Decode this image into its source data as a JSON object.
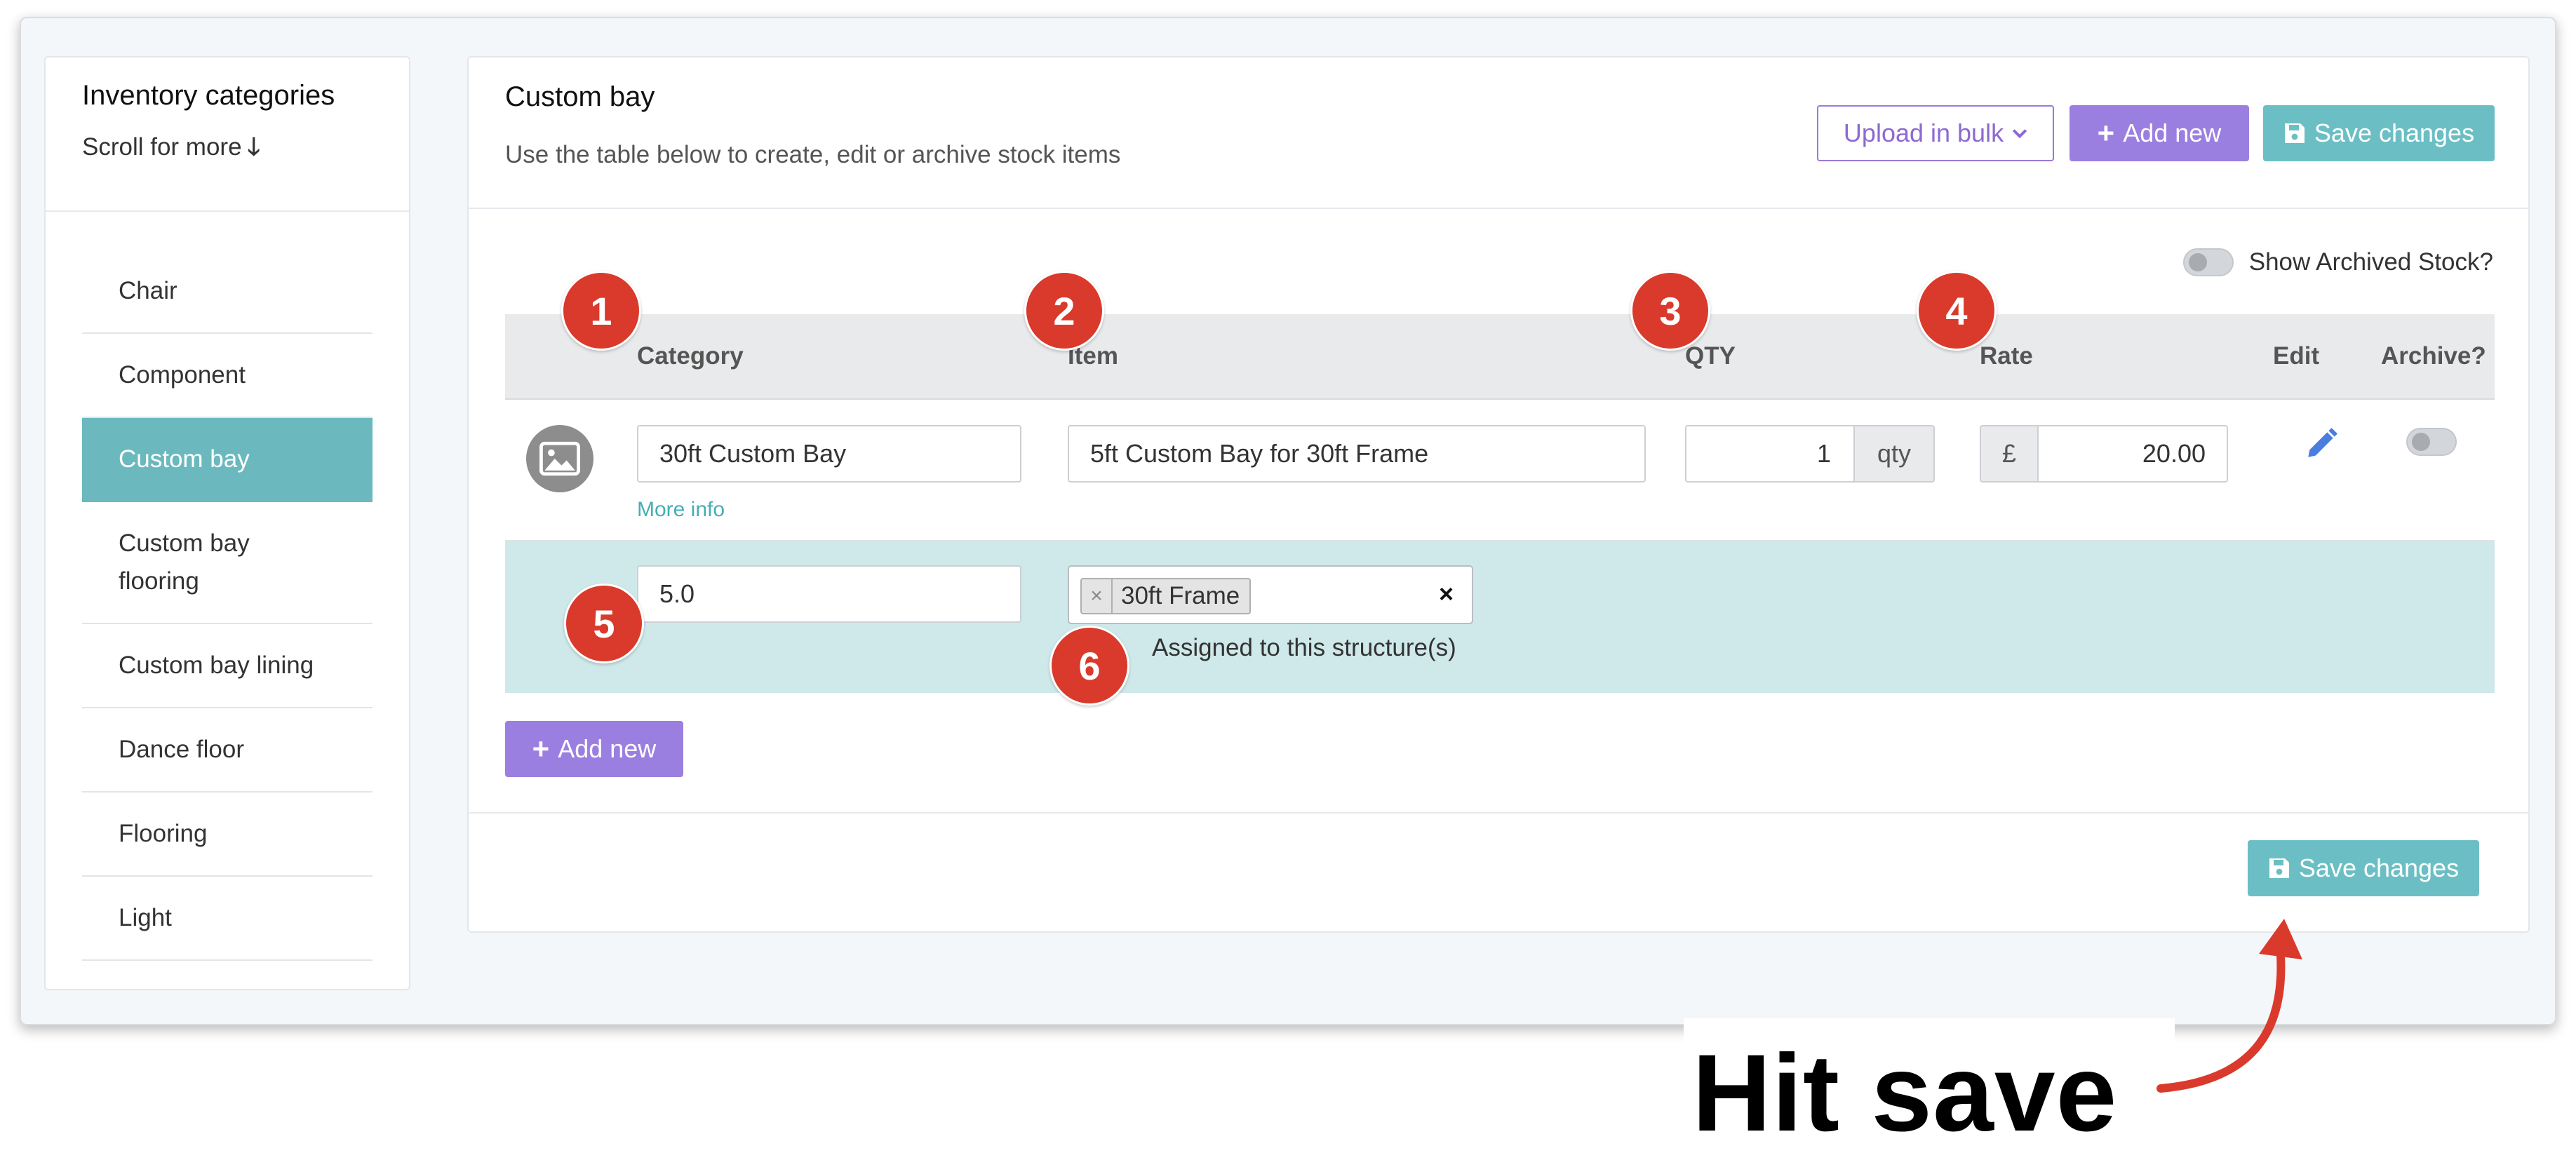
{
  "sidebar": {
    "title": "Inventory categories",
    "scroll_hint": "Scroll for more",
    "scroll_arrow": "🡓",
    "items": [
      {
        "label": "Chair"
      },
      {
        "label": "Component"
      },
      {
        "label": "Custom bay",
        "active": true
      },
      {
        "label": "Custom bay flooring"
      },
      {
        "label": "Custom bay lining"
      },
      {
        "label": "Dance floor"
      },
      {
        "label": "Flooring"
      },
      {
        "label": "Light"
      }
    ]
  },
  "main": {
    "title": "Custom bay",
    "subtitle": "Use the table below to create, edit or archive stock items",
    "upload_label": "Upload in bulk",
    "add_new_label": "Add new",
    "save_label": "Save changes",
    "show_archived_label": "Show Archived Stock?",
    "columns": {
      "category": "Category",
      "item": "Item",
      "qty": "QTY",
      "rate": "Rate",
      "edit": "Edit",
      "archive": "Archive?"
    },
    "row": {
      "category_value": "30ft Custom Bay",
      "more_info": "More info",
      "item_value": "5ft Custom Bay for 30ft Frame",
      "qty_value": "1",
      "qty_unit": "qty",
      "currency": "£",
      "rate_value": "20.00"
    },
    "detail": {
      "value": "5.0",
      "tag": "30ft Frame",
      "tag_remove": "×",
      "clear": "×",
      "assigned_label": "Assigned to this structure(s)"
    },
    "add_new_bottom_label": "Add new",
    "save_bottom_label": "Save changes"
  },
  "callouts": [
    "1",
    "2",
    "3",
    "4",
    "5",
    "6"
  ],
  "annotation": {
    "text": "Hit save"
  },
  "colors": {
    "accent_teal": "#6bb9be",
    "accent_purple": "#9b7fe0",
    "callout_red": "#d93a2b",
    "detail_row_bg": "#cfe9ea"
  },
  "icons": {
    "upload": "chevron-down-icon",
    "add": "plus-icon",
    "save": "floppy-disk-icon",
    "edit": "pencil-icon",
    "image": "image-placeholder-icon"
  }
}
